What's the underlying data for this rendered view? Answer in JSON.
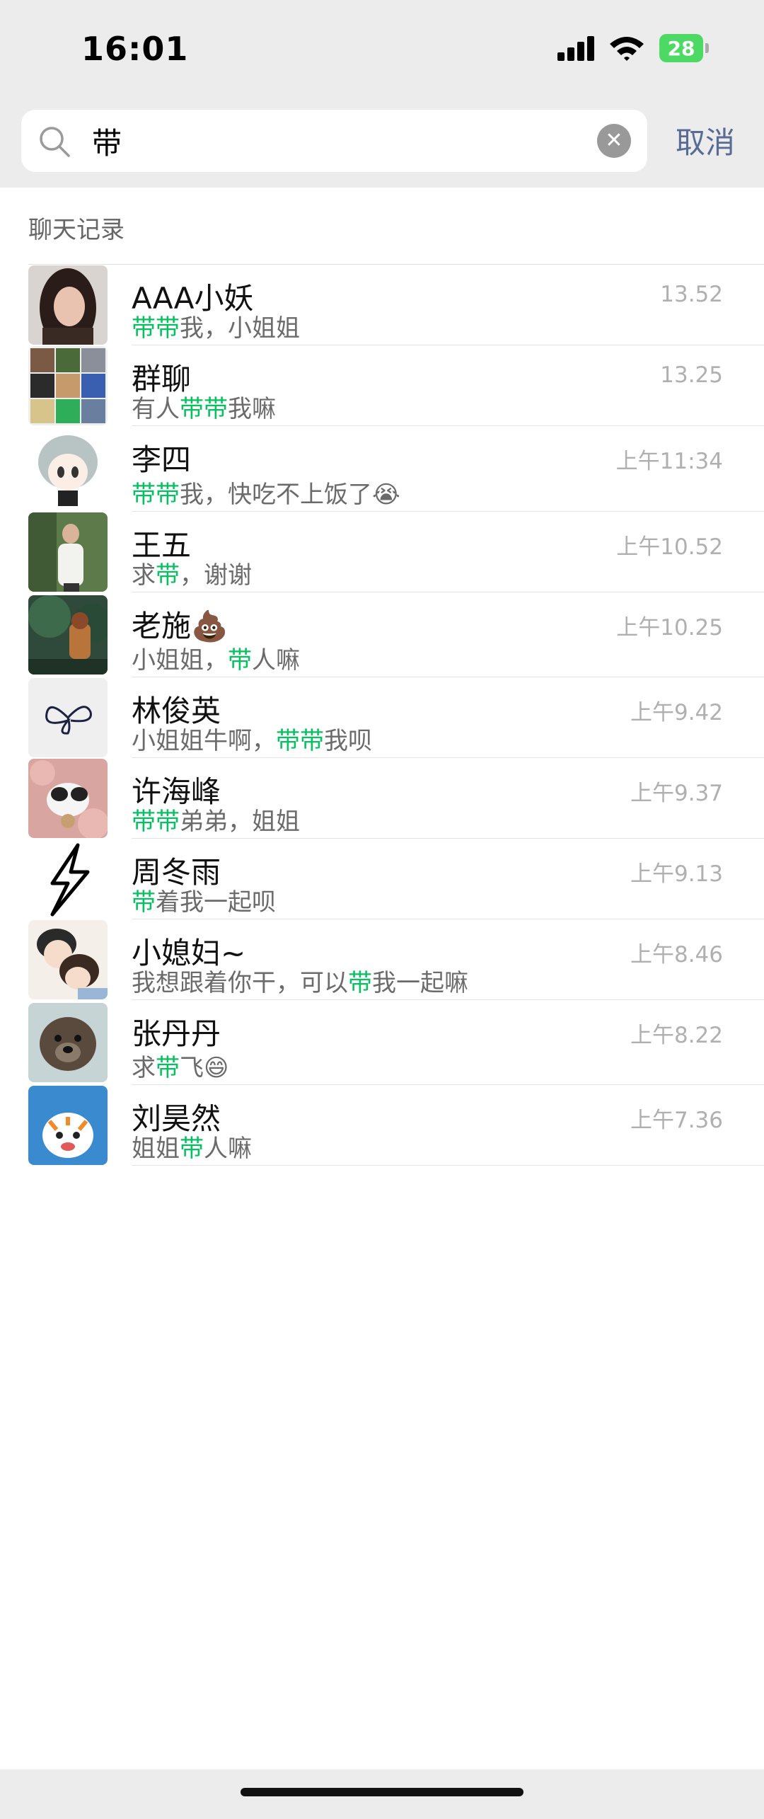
{
  "status_bar": {
    "time": "16:01",
    "battery": "28"
  },
  "search": {
    "query": "带",
    "cancel_label": "取消"
  },
  "section": {
    "title": "聊天记录"
  },
  "colors": {
    "highlight": "#07c160",
    "link": "#576b95",
    "timestamp": "#b0b0b0"
  },
  "results": [
    {
      "name": "AAA小妖",
      "time": "13.52",
      "snippet_parts": [
        {
          "t": "带带",
          "hl": true
        },
        {
          "t": "我，小姐姐",
          "hl": false
        }
      ],
      "avatar": "girl-photo-avatar"
    },
    {
      "name": "群聊",
      "time": "13.25",
      "snippet_parts": [
        {
          "t": "有人",
          "hl": false
        },
        {
          "t": "带带",
          "hl": true
        },
        {
          "t": "我嘛",
          "hl": false
        }
      ],
      "avatar": "group-grid-avatar"
    },
    {
      "name": "李四",
      "time": "上午11:34",
      "snippet_parts": [
        {
          "t": "带带",
          "hl": true
        },
        {
          "t": "我，快吃不上饭了😭",
          "hl": false
        }
      ],
      "avatar": "anime-boy-avatar"
    },
    {
      "name": "王五",
      "time": "上午10.52",
      "snippet_parts": [
        {
          "t": "求",
          "hl": false
        },
        {
          "t": "带",
          "hl": true
        },
        {
          "t": "，谢谢",
          "hl": false
        }
      ],
      "avatar": "man-photo-avatar"
    },
    {
      "name": "老施💩",
      "time": "上午10.25",
      "snippet_parts": [
        {
          "t": "小姐姐，",
          "hl": false
        },
        {
          "t": "带",
          "hl": true
        },
        {
          "t": "人嘛",
          "hl": false
        }
      ],
      "avatar": "forest-cartoon-avatar"
    },
    {
      "name": "林俊英",
      "time": "上午9.42",
      "snippet_parts": [
        {
          "t": "小姐姐牛啊，",
          "hl": false
        },
        {
          "t": "带带",
          "hl": true
        },
        {
          "t": "我呗",
          "hl": false
        }
      ],
      "avatar": "butterfly-sketch-avatar"
    },
    {
      "name": "许海峰",
      "time": "上午9.37",
      "snippet_parts": [
        {
          "t": "带带",
          "hl": true
        },
        {
          "t": "弟弟，姐姐",
          "hl": false
        }
      ],
      "avatar": "cat-photo-avatar"
    },
    {
      "name": "周冬雨",
      "time": "上午9.13",
      "snippet_parts": [
        {
          "t": "带",
          "hl": true
        },
        {
          "t": "着我一起呗",
          "hl": false
        }
      ],
      "avatar": "lightning-avatar"
    },
    {
      "name": "小媳妇~",
      "time": "上午8.46",
      "snippet_parts": [
        {
          "t": "我想跟着你干，可以",
          "hl": false
        },
        {
          "t": "带",
          "hl": true
        },
        {
          "t": "我一起嘛",
          "hl": false
        }
      ],
      "avatar": "couple-illustration-avatar"
    },
    {
      "name": "张丹丹",
      "time": "上午8.22",
      "snippet_parts": [
        {
          "t": "求",
          "hl": false
        },
        {
          "t": "带",
          "hl": true
        },
        {
          "t": "飞😄",
          "hl": false
        }
      ],
      "avatar": "puppy-photo-avatar"
    },
    {
      "name": "刘昊然",
      "time": "上午7.36",
      "snippet_parts": [
        {
          "t": "姐姐",
          "hl": false
        },
        {
          "t": "带",
          "hl": true
        },
        {
          "t": "人嘛",
          "hl": false
        }
      ],
      "avatar": "tiger-cartoon-avatar"
    }
  ]
}
